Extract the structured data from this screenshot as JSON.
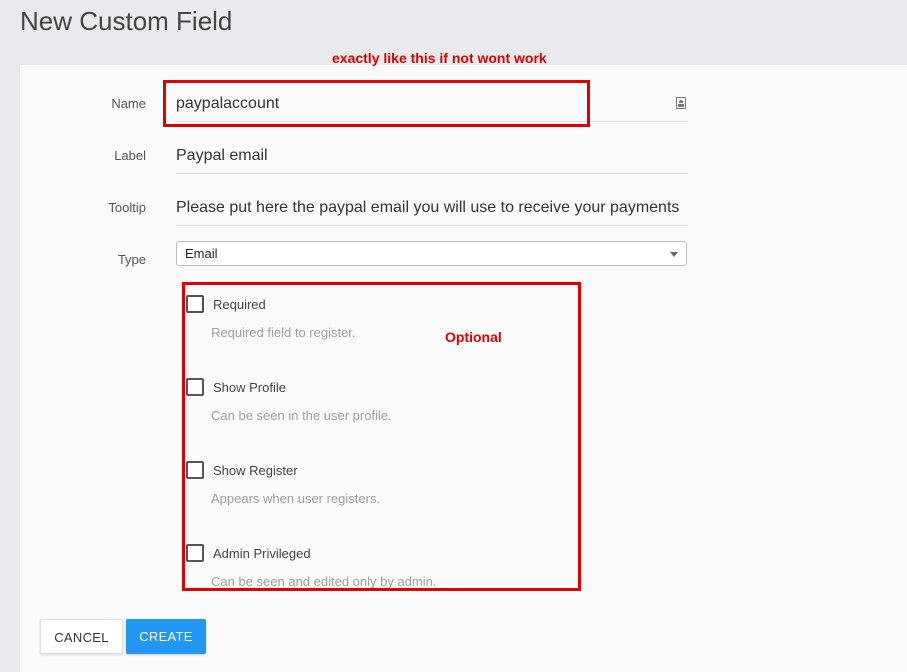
{
  "page": {
    "title": "New Custom Field"
  },
  "annotations": {
    "top_note": "exactly like this if not wont work",
    "optional_note": "Optional"
  },
  "form": {
    "name": {
      "label": "Name",
      "value": "paypalaccount",
      "icon": "contact-card-icon"
    },
    "label_field": {
      "label": "Label",
      "value": "Paypal email"
    },
    "tooltip": {
      "label": "Tooltip",
      "value": "Please put here the paypal email you will use to receive your payments"
    },
    "type": {
      "label": "Type",
      "selected": "Email"
    },
    "options": [
      {
        "label": "Required",
        "hint": "Required field to register.",
        "checked": false
      },
      {
        "label": "Show Profile",
        "hint": "Can be seen in the user profile.",
        "checked": false
      },
      {
        "label": "Show Register",
        "hint": "Appears when user registers.",
        "checked": false
      },
      {
        "label": "Admin Privileged",
        "hint": "Can be seen and edited only by admin.",
        "checked": false
      }
    ]
  },
  "actions": {
    "cancel_label": "CANCEL",
    "create_label": "CREATE"
  },
  "colors": {
    "annotation_red": "#e00000",
    "primary_blue": "#2196f3",
    "page_bg": "#e8eaed",
    "panel_bg": "#fafafa"
  }
}
